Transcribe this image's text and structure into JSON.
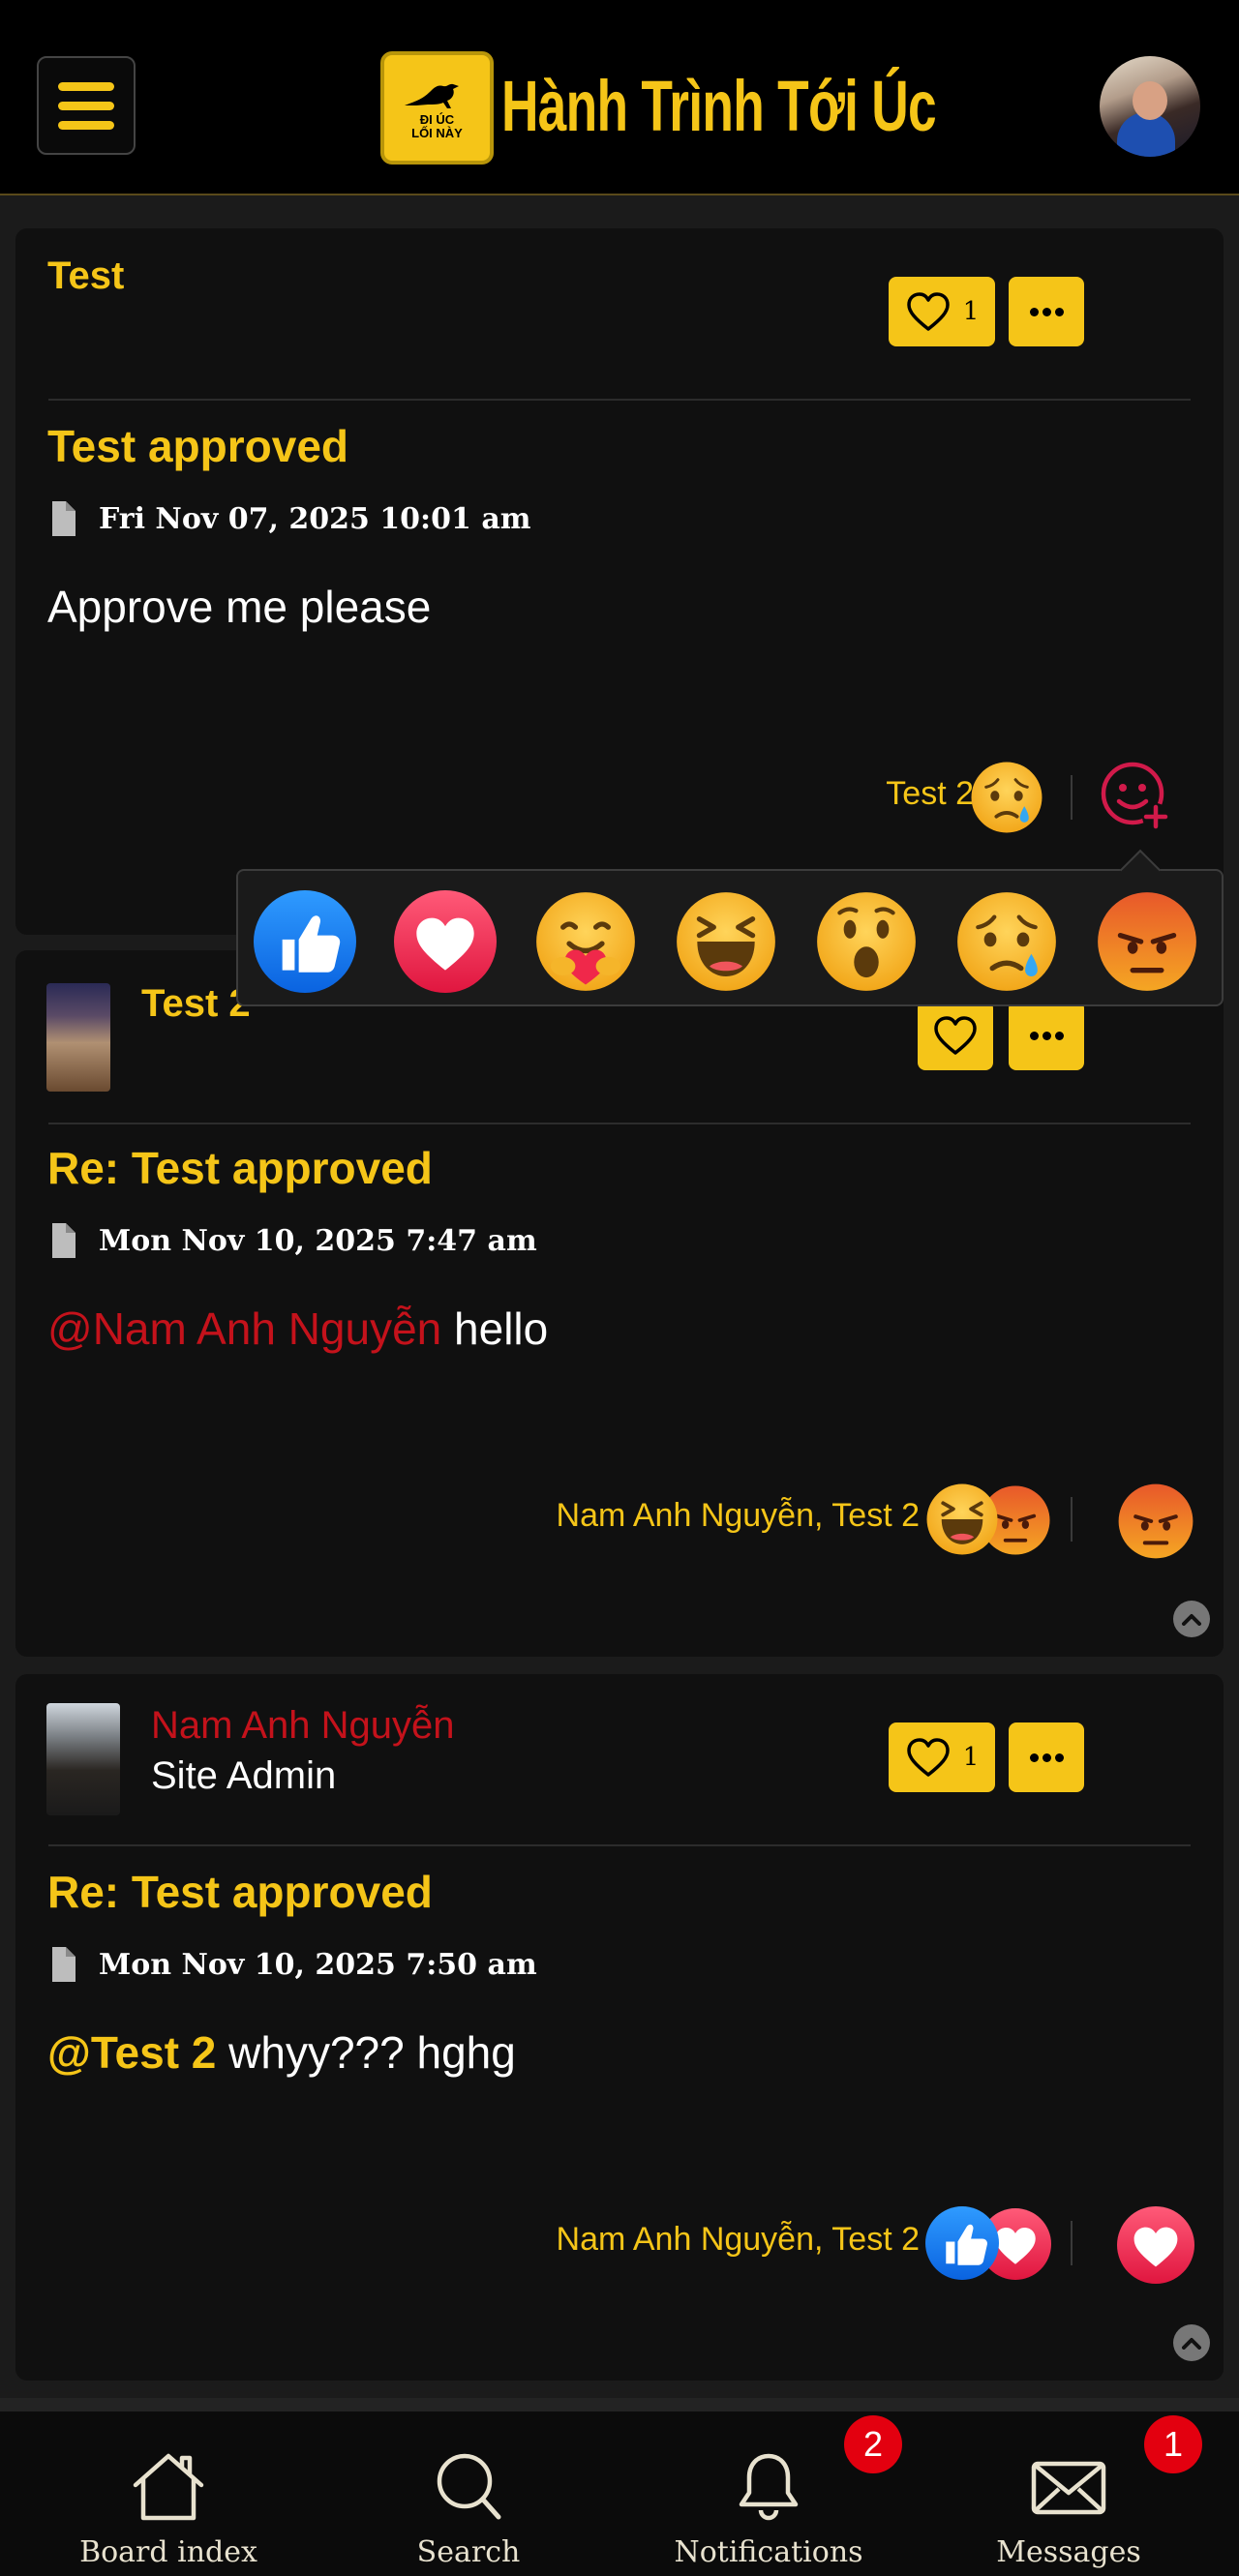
{
  "header": {
    "logo_badge_line1": "ĐI ÚC",
    "logo_badge_line2": "LỐI NÀY",
    "site_title": "Hành Trình Tới Úc",
    "accent_color": "#f5c518"
  },
  "reaction_picker": {
    "options": [
      "like",
      "love",
      "care",
      "haha",
      "wow",
      "sad",
      "angry"
    ]
  },
  "posts": [
    {
      "author": "Test",
      "rank": "",
      "like_count": "1",
      "title": "Test approved",
      "date": "Fri Nov 07, 2025 10:01 am",
      "body": "Approve me please",
      "reactors": "Test 2",
      "reactions": [
        "sad"
      ],
      "my_reaction": "add-reaction"
    },
    {
      "author": "Test 2",
      "rank": "",
      "like_count": "",
      "title": "Re: Test approved",
      "date": "Mon Nov 10, 2025 7:47 am",
      "mention": "@Nam Anh Nguyễn",
      "body": " hello",
      "reactors": "Nam Anh Nguyễn, Test 2",
      "reactions": [
        "haha",
        "angry"
      ],
      "my_reaction": "angry"
    },
    {
      "author": "Nam Anh Nguyễn",
      "rank": "Site Admin",
      "like_count": "1",
      "title": "Re: Test approved",
      "date": "Mon Nov 10, 2025 7:50 am",
      "mention": "@Test 2",
      "body": " whyy??? hghg",
      "reactors": "Nam Anh Nguyễn, Test 2",
      "reactions": [
        "like",
        "love"
      ],
      "my_reaction": "love"
    }
  ],
  "bottom_nav": {
    "items": [
      {
        "label": "Board index",
        "icon": "home-icon",
        "badge": ""
      },
      {
        "label": "Search",
        "icon": "search-icon",
        "badge": ""
      },
      {
        "label": "Notifications",
        "icon": "bell-icon",
        "badge": "2"
      },
      {
        "label": "Messages",
        "icon": "envelope-icon",
        "badge": "1"
      }
    ]
  }
}
